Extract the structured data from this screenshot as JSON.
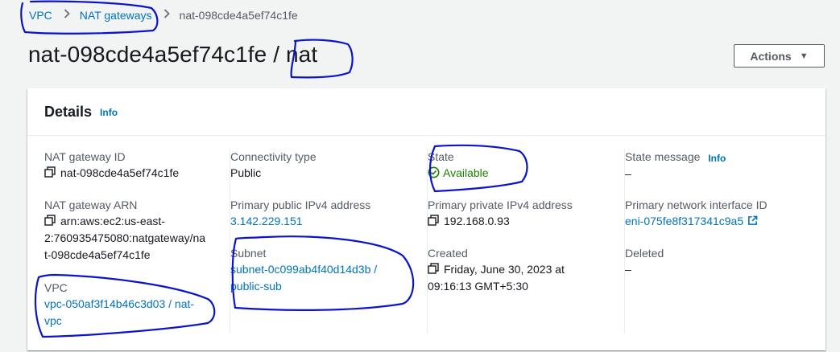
{
  "breadcrumb": {
    "items": [
      "VPC",
      "NAT gateways"
    ],
    "current": "nat-098cde4a5ef74c1fe"
  },
  "header": {
    "title": "nat-098cde4a5ef74c1fe / nat",
    "actions_label": "Actions"
  },
  "details": {
    "heading": "Details",
    "info_label": "Info",
    "nat_gateway_id": {
      "label": "NAT gateway ID",
      "value": "nat-098cde4a5ef74c1fe"
    },
    "nat_gateway_arn": {
      "label": "NAT gateway ARN",
      "value_lines": [
        "arn:aws:ec2:us-east-",
        "2:760935475080:natgateway/na",
        "t-098cde4a5ef74c1fe"
      ]
    },
    "vpc": {
      "label": "VPC",
      "value_lines": [
        "vpc-050af3f14b46c3d03 / nat-",
        "vpc"
      ]
    },
    "connectivity_type": {
      "label": "Connectivity type",
      "value": "Public"
    },
    "primary_public_ipv4": {
      "label": "Primary public IPv4 address",
      "value": "3.142.229.151"
    },
    "subnet": {
      "label": "Subnet",
      "value_lines": [
        "subnet-0c099ab4f40d14d3b /",
        "public-sub"
      ]
    },
    "state": {
      "label": "State",
      "value": "Available"
    },
    "primary_private_ipv4": {
      "label": "Primary private IPv4 address",
      "value": "192.168.0.93"
    },
    "created": {
      "label": "Created",
      "value_lines": [
        "Friday, June 30, 2023 at",
        "09:16:13 GMT+5:30"
      ]
    },
    "state_message": {
      "label": "State message",
      "info_label": "Info",
      "value": "–"
    },
    "primary_network_interface": {
      "label": "Primary network interface ID",
      "value": "eni-075fe8f317341c9a5"
    },
    "deleted": {
      "label": "Deleted",
      "value": "–"
    }
  },
  "icons": {
    "copy": "copy-icon",
    "available": "check-circle-icon",
    "external": "external-link-icon",
    "breadcrumb_separator": "chevron-right-icon",
    "actions_caret": "caret-down-icon"
  },
  "colors": {
    "link": "#0073bb",
    "success": "#1d8102",
    "annotation": "#0a14c8"
  }
}
